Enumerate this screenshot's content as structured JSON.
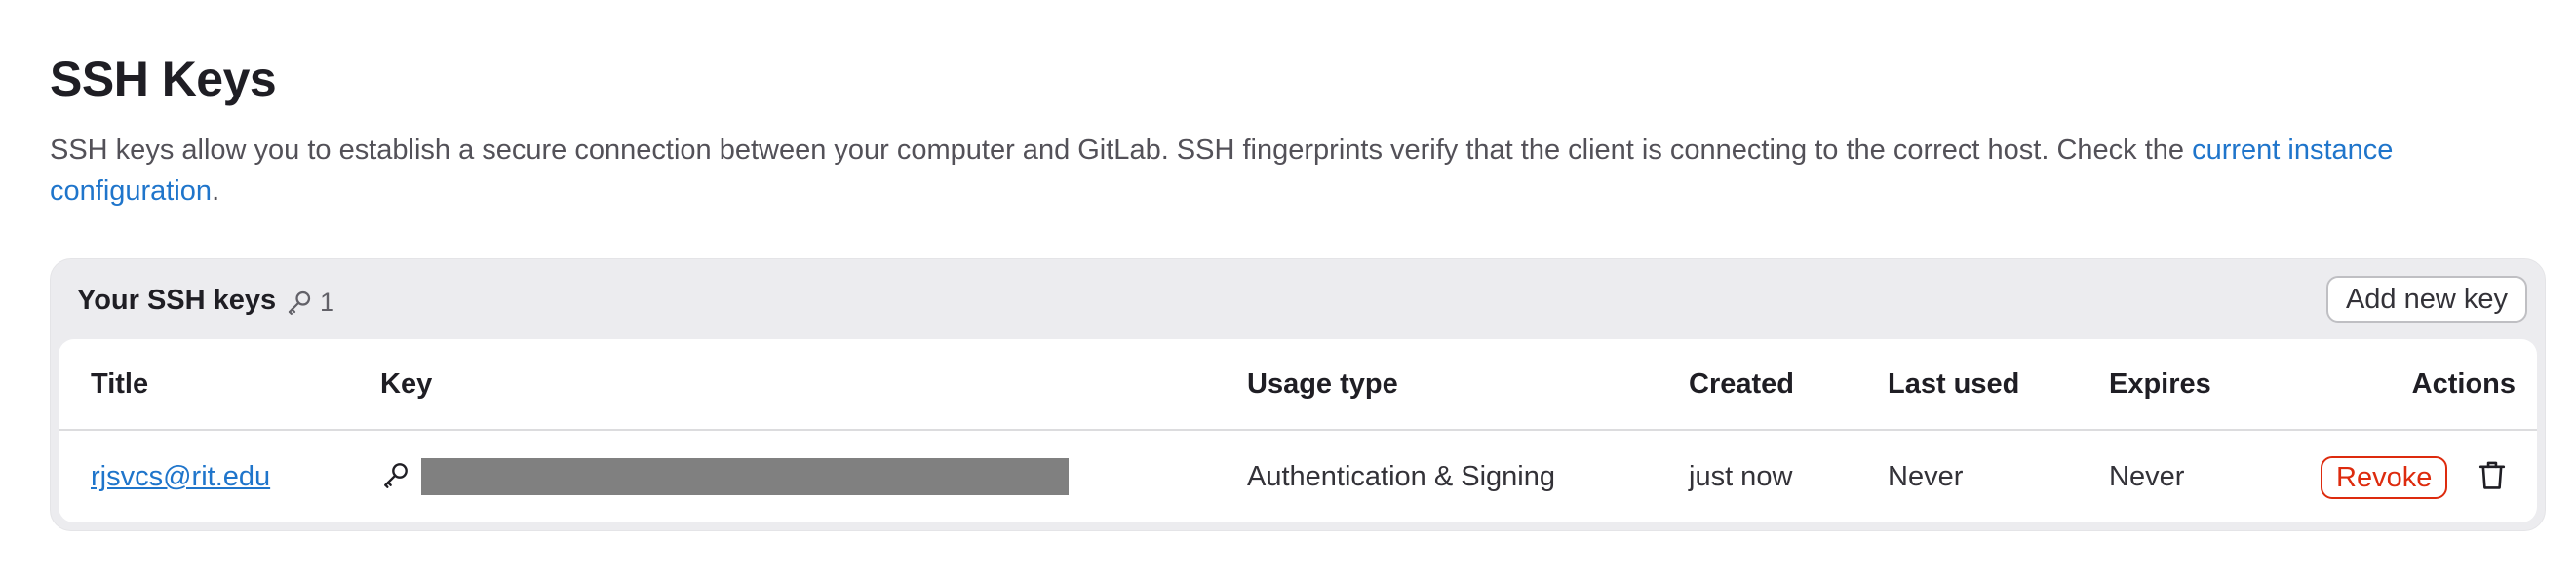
{
  "page": {
    "title": "SSH Keys",
    "description_text": "SSH keys allow you to establish a secure connection between your computer and GitLab. SSH fingerprints verify that the client is connecting to the correct host. Check the ",
    "description_link": "current instance configuration",
    "description_end": "."
  },
  "card": {
    "title": "Your SSH keys",
    "count": "1",
    "count_icon": "key-icon",
    "add_button": "Add new key"
  },
  "table": {
    "columns": [
      "Title",
      "Key",
      "Usage type",
      "Created",
      "Last used",
      "Expires",
      "Actions"
    ],
    "rows": [
      {
        "title": "rjsvcs@rit.edu",
        "key_icon": "key-icon",
        "usage_type": "Authentication & Signing",
        "created": "just now",
        "last_used": "Never",
        "expires": "Never",
        "revoke_label": "Revoke",
        "delete_icon": "trash-icon"
      }
    ]
  },
  "colors": {
    "link": "#1f75cb",
    "danger": "#dd2b0e",
    "card_bg": "#ececef",
    "redacted": "#808080"
  }
}
